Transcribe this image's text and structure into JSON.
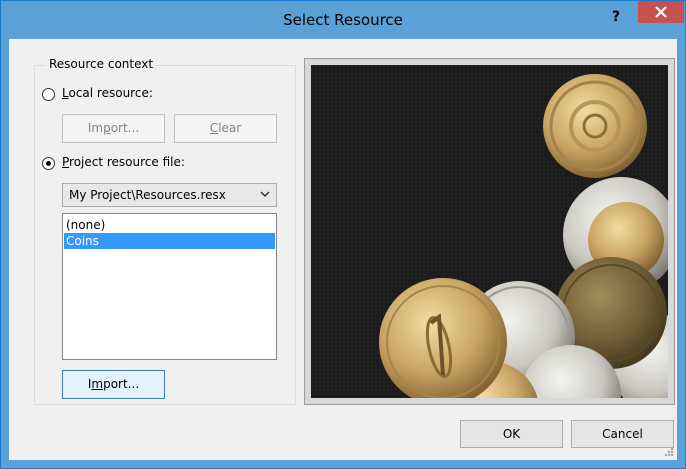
{
  "window": {
    "title": "Select Resource",
    "help": "?"
  },
  "group": {
    "legend": "Resource context",
    "local": {
      "label_mnemonic": "L",
      "label_rest": "ocal resource:",
      "selected": false
    },
    "import_small": {
      "pre": "Im",
      "mnemonic": "p",
      "rest": "ort..."
    },
    "clear": {
      "mnemonic": "C",
      "rest": "lear"
    },
    "project": {
      "label_mnemonic": "P",
      "label_rest": "roject resource file:",
      "selected": true
    },
    "select_value": "My Project\\Resources.resx",
    "list_items": [
      "(none)",
      "Coins"
    ],
    "selected_index": 1,
    "import_big": {
      "pre": "I",
      "mnemonic": "m",
      "rest": "port..."
    }
  },
  "footer": {
    "ok": "OK",
    "cancel": "Cancel"
  },
  "colors": {
    "titlebar": "#5aa1d8",
    "close": "#c75050",
    "selection": "#3399ff",
    "dialog_bg": "#f0f0f0"
  },
  "preview": {
    "subject": "coins-photo"
  }
}
